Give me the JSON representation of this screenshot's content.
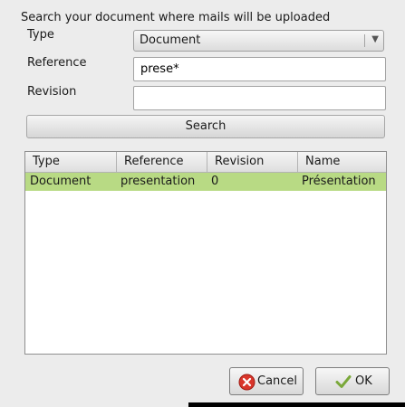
{
  "dialog": {
    "heading": "Search your document where mails will be uploaded"
  },
  "form": {
    "type_label": "Type",
    "type_value": "Document",
    "reference_label": "Reference",
    "reference_value": "prese*",
    "revision_label": "Revision",
    "revision_value": "",
    "search_label": "Search"
  },
  "results": {
    "columns": [
      "Type",
      "Reference",
      "Revision",
      "Name"
    ],
    "rows": [
      [
        "Document",
        "presentation",
        "0",
        "Présentation"
      ]
    ],
    "selected_row_color": "#b8da84"
  },
  "buttons": {
    "cancel_label": "Cancel",
    "cancel_icon": "cancel-icon",
    "ok_label": "OK",
    "ok_icon": "checkmark-icon"
  }
}
